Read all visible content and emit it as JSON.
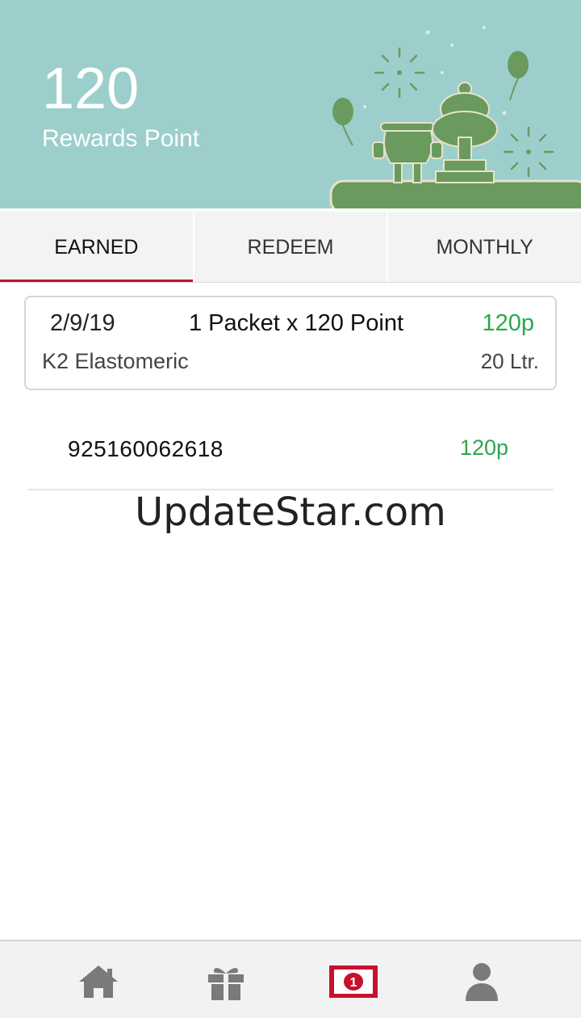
{
  "header": {
    "points": "120",
    "points_label": "Rewards Point"
  },
  "tabs": [
    {
      "label": "EARNED",
      "active": true
    },
    {
      "label": "REDEEM",
      "active": false
    },
    {
      "label": "MONTHLY",
      "active": false
    }
  ],
  "transaction": {
    "date": "2/9/19",
    "quantity": "1 Packet x 120 Point",
    "points": "120p",
    "product": "K2 Elastomeric",
    "size": "20 Ltr."
  },
  "code_row": {
    "code": "925160062618",
    "points": "120p"
  },
  "watermark": "UpdateStar.com",
  "bottom_nav": [
    {
      "icon": "home-icon"
    },
    {
      "icon": "gift-icon"
    },
    {
      "icon": "money-icon",
      "active": true
    },
    {
      "icon": "user-icon"
    }
  ],
  "colors": {
    "header_bg": "#9ccfcc",
    "accent_red": "#c8102e",
    "points_green": "#2aa84a",
    "illustration_green": "#6a9a5e"
  }
}
